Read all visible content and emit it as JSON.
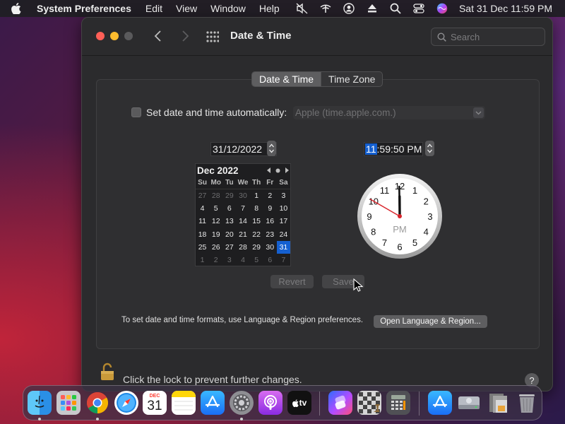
{
  "menubar": {
    "app_name": "System Preferences",
    "menus": [
      "Edit",
      "View",
      "Window",
      "Help"
    ],
    "clock": "Sat 31 Dec  11:59 PM"
  },
  "window": {
    "title": "Date & Time",
    "search_placeholder": "Search"
  },
  "tabs": [
    {
      "label": "Date & Time",
      "active": true
    },
    {
      "label": "Time Zone",
      "active": false
    }
  ],
  "auto_time": {
    "label": "Set date and time automatically:",
    "checked": false,
    "server": "Apple (time.apple.com.)"
  },
  "date_field": {
    "value": "31/12/2022"
  },
  "time_field": {
    "hour": "11",
    "rest": ":59:50 PM"
  },
  "calendar": {
    "month": "Dec 2022",
    "weekdays": [
      "Su",
      "Mo",
      "Tu",
      "We",
      "Th",
      "Fr",
      "Sa"
    ],
    "days": [
      {
        "d": "27",
        "dim": true
      },
      {
        "d": "28",
        "dim": true
      },
      {
        "d": "29",
        "dim": true
      },
      {
        "d": "30",
        "dim": true
      },
      {
        "d": "1"
      },
      {
        "d": "2"
      },
      {
        "d": "3"
      },
      {
        "d": "4"
      },
      {
        "d": "5"
      },
      {
        "d": "6"
      },
      {
        "d": "7"
      },
      {
        "d": "8"
      },
      {
        "d": "9"
      },
      {
        "d": "10"
      },
      {
        "d": "11"
      },
      {
        "d": "12"
      },
      {
        "d": "13"
      },
      {
        "d": "14"
      },
      {
        "d": "15"
      },
      {
        "d": "16"
      },
      {
        "d": "17"
      },
      {
        "d": "18"
      },
      {
        "d": "19"
      },
      {
        "d": "20"
      },
      {
        "d": "21"
      },
      {
        "d": "22"
      },
      {
        "d": "23"
      },
      {
        "d": "24"
      },
      {
        "d": "25"
      },
      {
        "d": "26"
      },
      {
        "d": "27"
      },
      {
        "d": "28"
      },
      {
        "d": "29"
      },
      {
        "d": "30"
      },
      {
        "d": "31",
        "sel": true
      },
      {
        "d": "1",
        "dim": true
      },
      {
        "d": "2",
        "dim": true
      },
      {
        "d": "3",
        "dim": true
      },
      {
        "d": "4",
        "dim": true
      },
      {
        "d": "5",
        "dim": true
      },
      {
        "d": "6",
        "dim": true
      },
      {
        "d": "7",
        "dim": true
      }
    ]
  },
  "clock": {
    "numbers": [
      "12",
      "1",
      "2",
      "3",
      "4",
      "5",
      "6",
      "7",
      "8",
      "9",
      "10",
      "11"
    ],
    "period": "PM",
    "hour": 11,
    "minute": 59,
    "second": 50
  },
  "buttons": {
    "revert": "Revert",
    "save": "Save",
    "language": "Open Language & Region..."
  },
  "footer": {
    "formats_text": "To set date and time formats, use Language & Region preferences.",
    "lock_text": "Click the lock to prevent further changes.",
    "help": "?"
  },
  "dock": {
    "calendar_month": "DEC",
    "calendar_day": "31",
    "tv_label": "tv"
  },
  "colors": {
    "accent": "#1560d0",
    "second_hand": "#d8232a"
  }
}
